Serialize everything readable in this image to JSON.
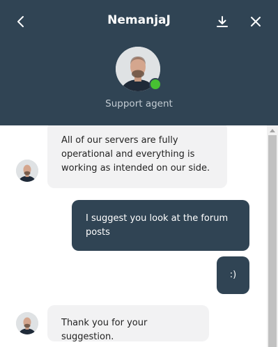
{
  "header": {
    "agent_name": "NemanjaJ",
    "agent_role": "Support agent",
    "status": "online",
    "icons": {
      "back": "chevron-left-icon",
      "download": "download-icon",
      "close": "close-icon"
    }
  },
  "messages": [
    {
      "sender": "agent",
      "text": "All of our servers are fully operational and everything is working as intended on our side."
    },
    {
      "sender": "user",
      "text": "I suggest you look at the forum posts"
    },
    {
      "sender": "user",
      "text": ":)"
    },
    {
      "sender": "agent",
      "text": "Thank you for your suggestion."
    }
  ],
  "colors": {
    "header_bg": "#304454",
    "user_bubble": "#304454",
    "agent_bubble": "#f2f2f3",
    "online": "#47c132"
  }
}
